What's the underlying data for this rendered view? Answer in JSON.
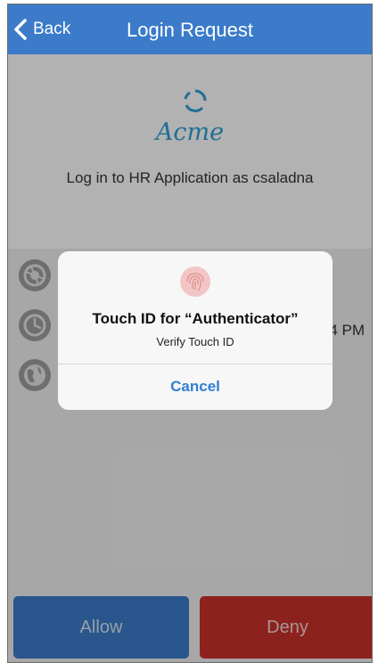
{
  "header": {
    "back_label": "Back",
    "title": "Login Request"
  },
  "request": {
    "logo_text": "Acme",
    "message": "Log in to HR Application as csaladna"
  },
  "details": {
    "time_fragment": "4 PM"
  },
  "actions": {
    "allow_label": "Allow",
    "deny_label": "Deny"
  },
  "touch_id_alert": {
    "title": "Touch ID for “Authenticator”",
    "message": "Verify Touch ID",
    "cancel_label": "Cancel"
  },
  "colors": {
    "brand_blue": "#3b7bc9",
    "deny_red": "#c8322c",
    "logo_blue": "#2f9fd4",
    "link_blue": "#2f7fd4"
  }
}
